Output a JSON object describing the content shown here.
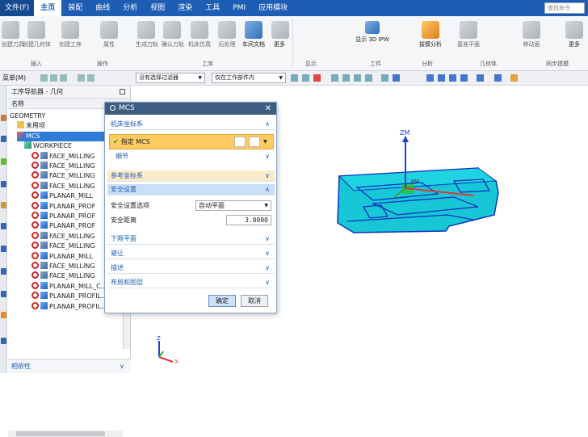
{
  "menubar": {
    "items": [
      "文件(F)",
      "主页",
      "装配",
      "曲线",
      "分析",
      "视图",
      "渲染",
      "工具",
      "PMI",
      "应用模块"
    ],
    "active_index": 1,
    "search_placeholder": "查找命令"
  },
  "ribbon": {
    "buttons": [
      {
        "label": "创建刀具",
        "icon": "tool-icon"
      },
      {
        "label": "创建几何体",
        "icon": "geometry-icon"
      },
      {
        "label": "创建工序",
        "icon": "operation-icon"
      },
      {
        "label": "属性",
        "icon": "properties-icon"
      },
      {
        "label": "生成刀轨",
        "icon": "generate-path-icon"
      },
      {
        "label": "确认刀轨",
        "icon": "verify-path-icon"
      },
      {
        "label": "机床仿真",
        "icon": "machine-sim-icon"
      },
      {
        "label": "后处理",
        "icon": "postprocess-icon"
      },
      {
        "label": "车间文档",
        "icon": "shop-doc-icon"
      },
      {
        "label": "更多",
        "icon": "more-icon"
      },
      {
        "label": "显示 3D IPW",
        "icon": "ipw-icon"
      },
      {
        "label": "拔模分析",
        "icon": "draft-analysis-icon"
      },
      {
        "label": "基准平面",
        "icon": "datum-icon"
      },
      {
        "label": "移动面",
        "icon": "move-face-icon"
      },
      {
        "label": "更多",
        "icon": "more-icon-2"
      }
    ],
    "groups": [
      "插入",
      "操作",
      "工序",
      "显示",
      "工件",
      "分析",
      "几何体",
      "同步建模"
    ]
  },
  "selection_bar": {
    "menu_label": "菜单(M)",
    "filter_value": "没有选择过滤器",
    "scope_value": "仅在工作部件内"
  },
  "navigator": {
    "title": "工序导航器 - 几何",
    "column": "名称",
    "rows": [
      {
        "text": "GEOMETRY",
        "indent": 0,
        "icon": ""
      },
      {
        "text": "未用项",
        "indent": 1,
        "icon": "fold"
      },
      {
        "text": "MCS",
        "indent": 1,
        "icon": "mcs"
      },
      {
        "text": "WORKPIECE",
        "indent": 2,
        "icon": "wp"
      },
      {
        "text": "FACE_MILLING",
        "indent": 3,
        "icon": "mill"
      },
      {
        "text": "FACE_MILLING",
        "indent": 3,
        "icon": "mill"
      },
      {
        "text": "FACE_MILLING",
        "indent": 3,
        "icon": "mill"
      },
      {
        "text": "FACE_MILLING",
        "indent": 3,
        "icon": "mill"
      },
      {
        "text": "PLANAR_MILL",
        "indent": 3,
        "icon": "planar"
      },
      {
        "text": "PLANAR_PROF",
        "indent": 3,
        "icon": "planar"
      },
      {
        "text": "PLANAR_PROF",
        "indent": 3,
        "icon": "planar"
      },
      {
        "text": "PLANAR_PROF",
        "indent": 3,
        "icon": "planar"
      },
      {
        "text": "FACE_MILLING",
        "indent": 3,
        "icon": "mill"
      },
      {
        "text": "FACE_MILLING",
        "indent": 3,
        "icon": "mill"
      },
      {
        "text": "PLANAR_MILL",
        "indent": 3,
        "icon": "planar"
      },
      {
        "text": "FACE_MILLING",
        "indent": 3,
        "icon": "mill"
      },
      {
        "text": "FACE_MILLING",
        "indent": 3,
        "icon": "mill"
      },
      {
        "text": "PLANAR_MILL_C...",
        "indent": 3,
        "icon": "planar"
      },
      {
        "text": "PLANAR_PROFIL...",
        "indent": 3,
        "icon": "planar"
      },
      {
        "text": "PLANAR_PROFIL...",
        "indent": 3,
        "icon": "planar"
      }
    ],
    "dependency_label": "相依性"
  },
  "dialog": {
    "title": "MCS",
    "sections": {
      "machine_csys": "机床坐标系",
      "specify_mcs": "指定 MCS",
      "details": "细节",
      "reference_csys": "参考坐标系",
      "safe_settings": "安全设置",
      "safe_option_label": "安全设置选项",
      "safe_option_value": "自动平面",
      "safe_distance_label": "安全距离",
      "safe_distance_value": "3.0000",
      "lower_plane": "下限平面",
      "avoidance": "避让",
      "description": "描述",
      "layout_layers": "布局和图层"
    },
    "ok_label": "确定",
    "cancel_label": "取消"
  },
  "viewport": {
    "axis_zm": "ZM",
    "axis_xm": "XM",
    "axis_z": "Z",
    "axis_x": "X"
  }
}
